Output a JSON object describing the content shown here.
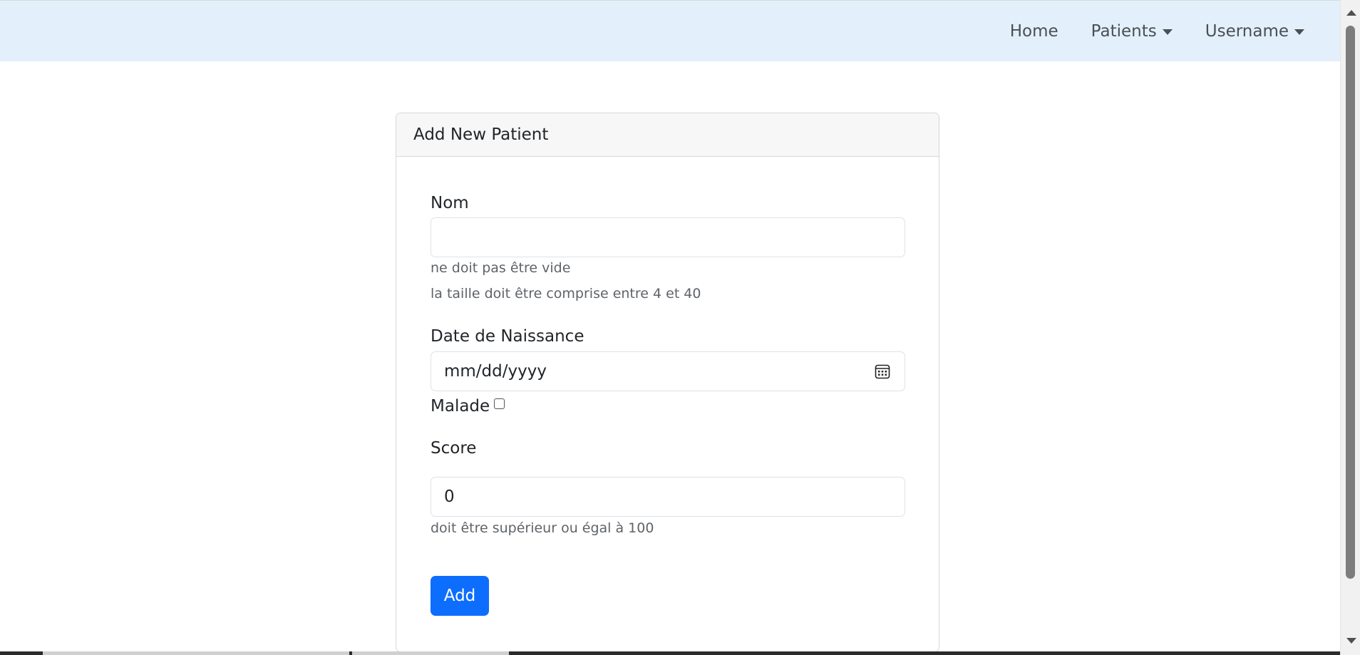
{
  "navbar": {
    "home_label": "Home",
    "patients_label": "Patients",
    "username_label": "Username"
  },
  "form": {
    "title": "Add New Patient",
    "nom": {
      "label": "Nom",
      "value": "",
      "errors": [
        "ne doit pas être vide",
        "la taille doit être comprise entre 4 et 40"
      ]
    },
    "date_naissance": {
      "label": "Date de Naissance",
      "placeholder": "mm/dd/yyyy"
    },
    "malade": {
      "label": "Malade",
      "checked": false
    },
    "score": {
      "label": "Score",
      "value": "0",
      "error": "doit être supérieur ou égal à 100"
    },
    "submit_label": "Add"
  },
  "colors": {
    "navbar_bg": "#e3f0fb",
    "primary": "#0d6efd"
  }
}
